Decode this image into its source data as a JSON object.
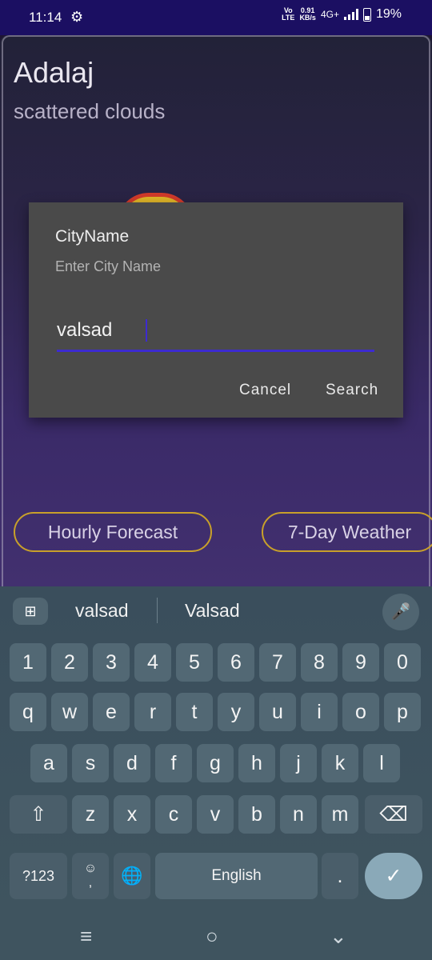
{
  "status_bar": {
    "time": "11:14",
    "volte": "VoLTE",
    "data_rate_top": "0.91",
    "data_rate_bottom": "KB/s",
    "network": "4G+",
    "battery": "19%"
  },
  "weather": {
    "city": "Adalaj",
    "description": "scattered clouds",
    "hourly_button": "Hourly Forecast",
    "weekly_button": "7-Day Weather"
  },
  "dialog": {
    "title": "CityName",
    "message": "Enter City Name",
    "input_value": "valsad",
    "cancel": "Cancel",
    "search": "Search"
  },
  "keyboard": {
    "suggestions": [
      "valsad",
      "Valsad"
    ],
    "number_row": [
      "1",
      "2",
      "3",
      "4",
      "5",
      "6",
      "7",
      "8",
      "9",
      "0"
    ],
    "row1": [
      "q",
      "w",
      "e",
      "r",
      "t",
      "y",
      "u",
      "i",
      "o",
      "p"
    ],
    "row2": [
      "a",
      "s",
      "d",
      "f",
      "g",
      "h",
      "j",
      "k",
      "l"
    ],
    "row3": [
      "z",
      "x",
      "c",
      "v",
      "b",
      "n",
      "m"
    ],
    "symbols_key": "?123",
    "space_label": "English",
    "period": ".",
    "comma": ","
  },
  "colors": {
    "status_bar": "#1b0f62",
    "dialog_bg": "#4a4a4a",
    "accent": "#3d2bd0",
    "pill_border": "#c8a02a",
    "keyboard_bg": "#3f545f"
  }
}
